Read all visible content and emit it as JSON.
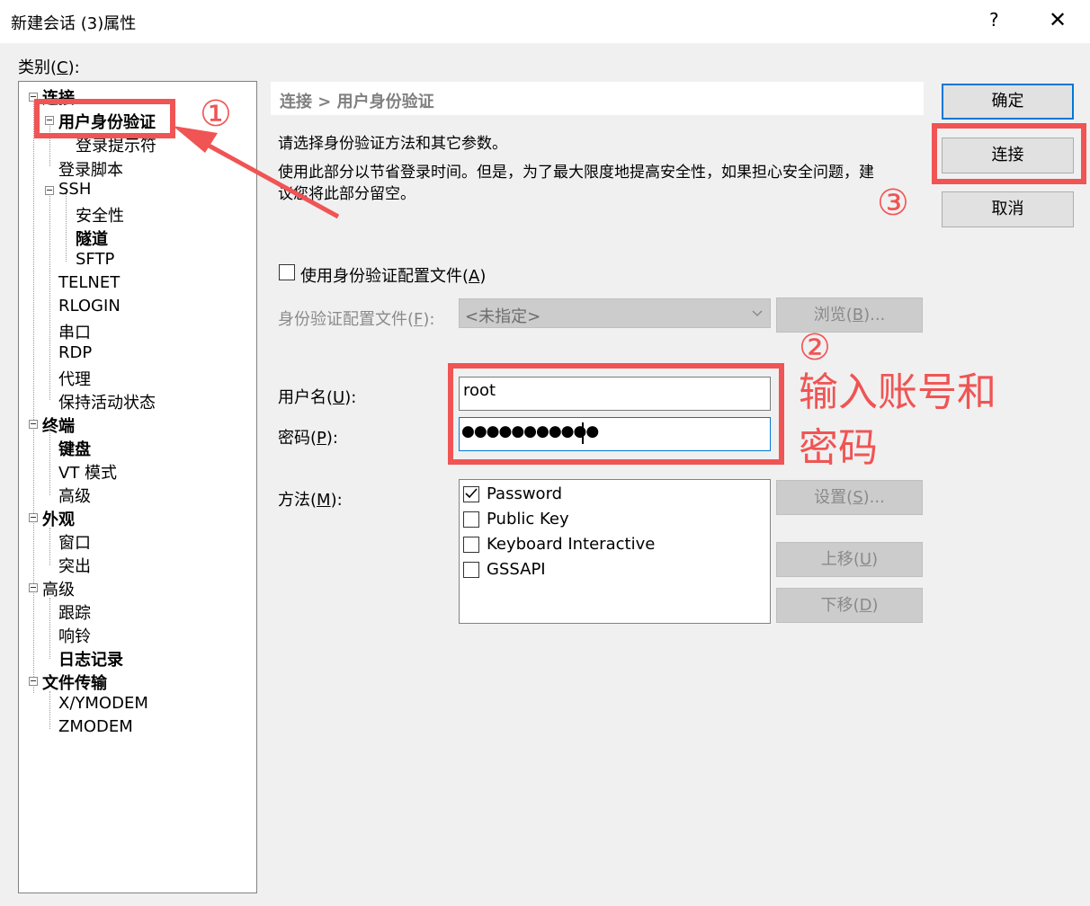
{
  "window": {
    "title": "新建会话 (3)属性",
    "help": "?",
    "close": "✕"
  },
  "category": {
    "label": "类别(C):",
    "tree": [
      {
        "label": "连接",
        "bold": true
      },
      {
        "label": "用户身份验证",
        "bold": true
      },
      {
        "label": "登录提示符",
        "bold": false
      },
      {
        "label": "登录脚本",
        "bold": false
      },
      {
        "label": "SSH",
        "bold": false
      },
      {
        "label": "安全性",
        "bold": false
      },
      {
        "label": "隧道",
        "bold": true
      },
      {
        "label": "SFTP",
        "bold": false
      },
      {
        "label": "TELNET",
        "bold": false
      },
      {
        "label": "RLOGIN",
        "bold": false
      },
      {
        "label": "串口",
        "bold": false
      },
      {
        "label": "RDP",
        "bold": false
      },
      {
        "label": "代理",
        "bold": false
      },
      {
        "label": "保持活动状态",
        "bold": false
      },
      {
        "label": "终端",
        "bold": true
      },
      {
        "label": "键盘",
        "bold": true
      },
      {
        "label": "VT 模式",
        "bold": false
      },
      {
        "label": "高级",
        "bold": false
      },
      {
        "label": "外观",
        "bold": true
      },
      {
        "label": "窗口",
        "bold": false
      },
      {
        "label": "突出",
        "bold": false
      },
      {
        "label": "高级",
        "bold": false
      },
      {
        "label": "跟踪",
        "bold": false
      },
      {
        "label": "响铃",
        "bold": false
      },
      {
        "label": "日志记录",
        "bold": true
      },
      {
        "label": "文件传输",
        "bold": true
      },
      {
        "label": "X/YMODEM",
        "bold": false
      },
      {
        "label": "ZMODEM",
        "bold": false
      }
    ]
  },
  "panel": {
    "breadcrumb": "连接 > 用户身份验证",
    "desc1": "请选择身份验证方法和其它参数。",
    "desc2a": "使用此部分以节省登录时间。但是，为了最大限度地提高安全性，如果担心安全问题，建",
    "desc2b": "议您将此部分留空。",
    "use_profile_label": "使用身份验证配置文件(A)",
    "profile_label": "身份验证配置文件(F):",
    "profile_value": "<未指定>",
    "browse_button": "浏览(B)...",
    "username_label": "用户名(U):",
    "username_value": "root",
    "password_label": "密码(P):",
    "password_value": "●●●●●●●●●●●",
    "method_label": "方法(M):",
    "methods": [
      {
        "label": "Password",
        "checked": true
      },
      {
        "label": "Public Key",
        "checked": false
      },
      {
        "label": "Keyboard Interactive",
        "checked": false
      },
      {
        "label": "GSSAPI",
        "checked": false
      }
    ],
    "settings_button": "设置(S)...",
    "move_up_button": "上移(U)",
    "move_down_button": "下移(D)"
  },
  "buttons": {
    "ok": "确定",
    "connect": "连接",
    "cancel": "取消"
  },
  "annotations": {
    "step1": "①",
    "step2": "②",
    "step3": "③",
    "note_line1": "输入账号和",
    "note_line2": "密码",
    "color": "#f05454"
  }
}
